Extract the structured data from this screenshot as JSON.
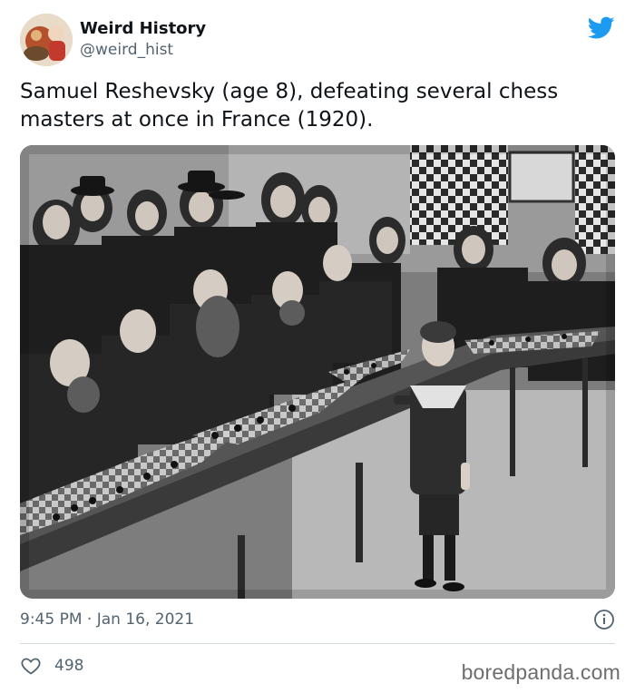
{
  "author": {
    "display_name": "Weird History",
    "handle": "@weird_hist",
    "avatar_icon": "avatar-image"
  },
  "tweet": {
    "text": "Samuel Reshevsky (age 8), defeating several chess masters at once in France (1920).",
    "timestamp": "9:45 PM · Jan 16, 2021"
  },
  "engagement": {
    "likes": "498",
    "like_icon": "heart-icon",
    "info_icon": "info-icon"
  },
  "brand": {
    "logo_icon": "twitter-bird-icon",
    "accent_color": "#1d9bf0"
  },
  "watermark": "boredpanda.com"
}
